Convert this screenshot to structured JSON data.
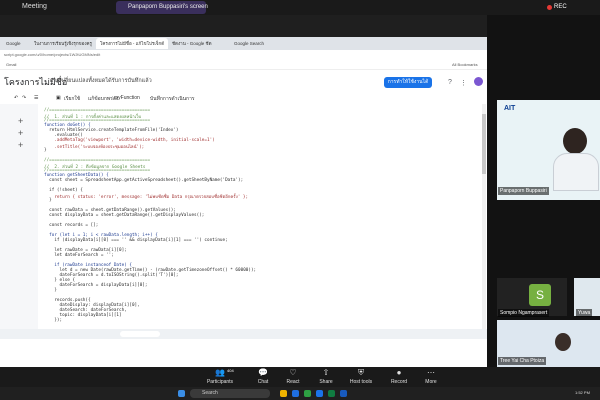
{
  "zoom_top": {
    "app_title": "Meeting",
    "share_label": "Panpaporn Buppasiri's screen",
    "rec_label": "REC"
  },
  "browser": {
    "tabs": [
      "Google",
      "ใบงานการเรียนรู้เชิงรุกของครู",
      "โครงการไม่มีชื่อ - แก้ไขโปรเจ็กต์",
      "ชีตงาน - Google ชีต",
      "Google Search"
    ],
    "address": "script.google.com/u/0/home/projects/1WJtUGMNs/edit",
    "bookmarks": [
      "Gmail",
      "All Bookmarks"
    ]
  },
  "gas": {
    "project_title": "โครงการไม่มีชื่อ",
    "subtitle": "การเปลี่ยนแปลงทั้งหมดได้รับการบันทึกแล้ว",
    "deploy_label": "การทำให้ใช้งานได้",
    "toolbar": {
      "run": "เรียกใช้",
      "debug": "แก้ข้อบกพร่อง",
      "function_select": "myFunction",
      "exec_log": "บันทึกการดำเนินการ"
    }
  },
  "code_lines": [
    {
      "t": "//=======================================",
      "k": "c"
    },
    {
      "t": "//  1. ส่วนที่ 1 : การตั้งค่าและแสดงผลหน้าเว็บ",
      "k": "c"
    },
    {
      "t": "//=======================================",
      "k": "c"
    },
    {
      "t": "function doGet() {",
      "k": "k"
    },
    {
      "t": "  return HtmlService.createTemplateFromFile('Index')",
      "k": ""
    },
    {
      "t": "    .evaluate()",
      "k": ""
    },
    {
      "t": "    .addMetaTag('viewport', 'width=device-width, initial-scale=1')",
      "k": "s"
    },
    {
      "t": "    .setTitle('ระบบจองห้องประชุมออนไลน์');",
      "k": "s"
    },
    {
      "t": "}",
      "k": ""
    },
    {
      "t": "",
      "k": ""
    },
    {
      "t": "//=======================================",
      "k": "c"
    },
    {
      "t": "//  2. ส่วนที่ 2 : ดึงข้อมูลจาก Google Sheets",
      "k": "c"
    },
    {
      "t": "//=======================================",
      "k": "c"
    },
    {
      "t": "function getSheetData() {",
      "k": "k"
    },
    {
      "t": "  const sheet = SpreadsheetApp.getActiveSpreadsheet().getSheetByName('Data');",
      "k": ""
    },
    {
      "t": "",
      "k": ""
    },
    {
      "t": "  if (!sheet) {",
      "k": ""
    },
    {
      "t": "    return { status: 'error', message: 'ไม่พบชีตชื่อ Data กรุณาตรวจสอบชื่อชีตอีกครั้ง' };",
      "k": "s"
    },
    {
      "t": "  }",
      "k": ""
    },
    {
      "t": "",
      "k": ""
    },
    {
      "t": "  const rawData = sheet.getDataRange().getValues();",
      "k": ""
    },
    {
      "t": "  const displayData = sheet.getDataRange().getDisplayValues();",
      "k": ""
    },
    {
      "t": "",
      "k": ""
    },
    {
      "t": "  const records = [];",
      "k": ""
    },
    {
      "t": "",
      "k": ""
    },
    {
      "t": "  for (let i = 1; i < rawData.length; i++) {",
      "k": "k"
    },
    {
      "t": "    if (displayData[i][0] === '' && displayData[i][1] === '') continue;",
      "k": ""
    },
    {
      "t": "",
      "k": ""
    },
    {
      "t": "    let rawDate = rawData[i][0];",
      "k": ""
    },
    {
      "t": "    let dateForSearch = '';",
      "k": ""
    },
    {
      "t": "",
      "k": ""
    },
    {
      "t": "    if (rawDate instanceof Date) {",
      "k": "k"
    },
    {
      "t": "      let d = new Date(rawDate.getTime() - (rawDate.getTimezoneOffset() * 60000));",
      "k": ""
    },
    {
      "t": "      dateForSearch = d.toISOString().split('T')[0];",
      "k": ""
    },
    {
      "t": "    } else {",
      "k": ""
    },
    {
      "t": "      dateForSearch = displayData[i][0];",
      "k": ""
    },
    {
      "t": "    }",
      "k": ""
    },
    {
      "t": "",
      "k": ""
    },
    {
      "t": "    records.push({",
      "k": ""
    },
    {
      "t": "      dateDisplay: displayData[i][0],",
      "k": ""
    },
    {
      "t": "      dateSearch: dateForSearch,",
      "k": ""
    },
    {
      "t": "      topic: displayData[i][1]",
      "k": ""
    },
    {
      "t": "    });",
      "k": ""
    }
  ],
  "participants": {
    "presenter_name": "Panpaporn Buppasiri",
    "presenter_logo": "AIT",
    "tile2_name": "Sompio Ngamprasert",
    "tile2_initial": "S",
    "tile3_name": "Tree Yai Cha Ptoiza",
    "tile_small_name": "Yuwa"
  },
  "zoom_bottom": {
    "participants_label": "Participants",
    "participants_count": "404",
    "chat_label": "Chat",
    "react_label": "React",
    "share_label": "Share",
    "host_tools_label": "Host tools",
    "record_label": "Record",
    "more_label": "More"
  },
  "taskbar": {
    "search_placeholder": "Search",
    "time": "1:52 PM"
  }
}
